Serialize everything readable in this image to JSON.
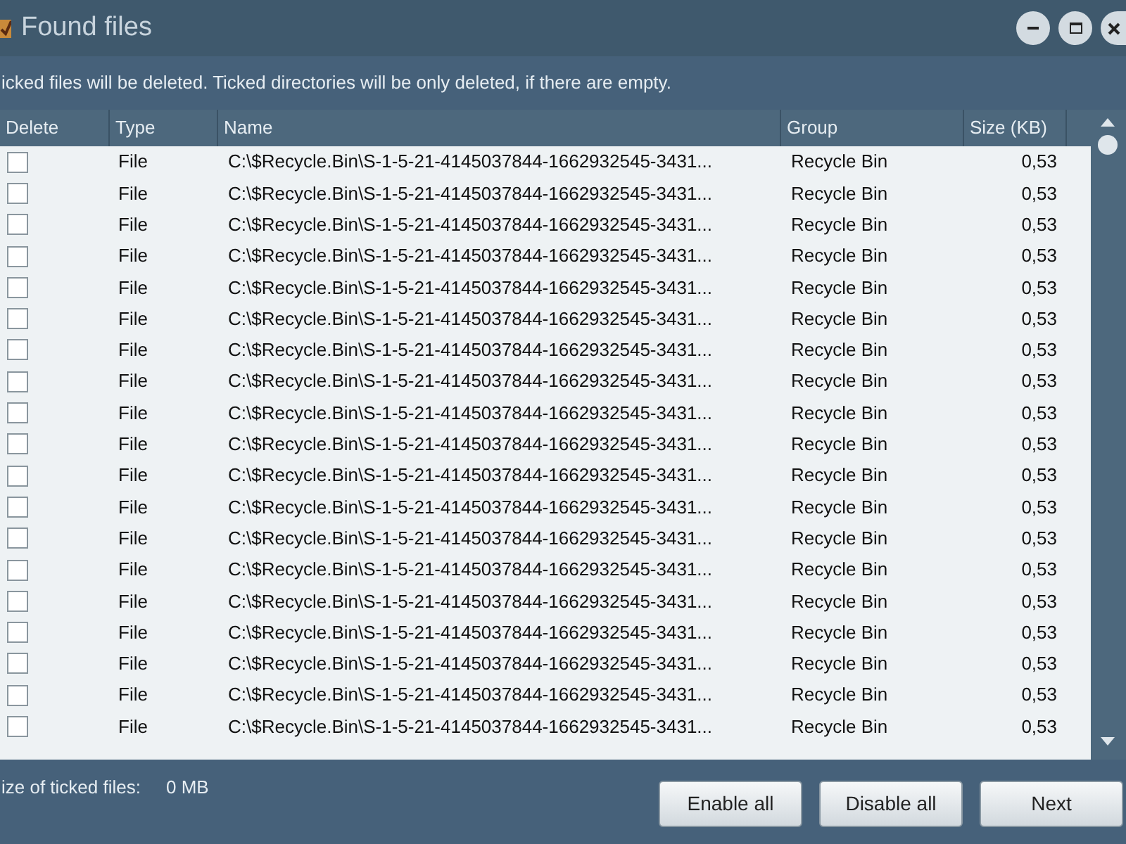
{
  "window": {
    "title": "Found files"
  },
  "message": "icked files will be deleted. Ticked directories will be only deleted, if there are empty.",
  "table": {
    "columns": [
      "Delete",
      "Type",
      "Name",
      "Group",
      "Size (KB)"
    ],
    "rows": [
      {
        "checked": false,
        "type": "File",
        "name": "C:\\$Recycle.Bin\\S-1-5-21-4145037844-1662932545-3431...",
        "group": "Recycle Bin",
        "size": "0,53"
      },
      {
        "checked": false,
        "type": "File",
        "name": "C:\\$Recycle.Bin\\S-1-5-21-4145037844-1662932545-3431...",
        "group": "Recycle Bin",
        "size": "0,53"
      },
      {
        "checked": false,
        "type": "File",
        "name": "C:\\$Recycle.Bin\\S-1-5-21-4145037844-1662932545-3431...",
        "group": "Recycle Bin",
        "size": "0,53"
      },
      {
        "checked": false,
        "type": "File",
        "name": "C:\\$Recycle.Bin\\S-1-5-21-4145037844-1662932545-3431...",
        "group": "Recycle Bin",
        "size": "0,53"
      },
      {
        "checked": false,
        "type": "File",
        "name": "C:\\$Recycle.Bin\\S-1-5-21-4145037844-1662932545-3431...",
        "group": "Recycle Bin",
        "size": "0,53"
      },
      {
        "checked": false,
        "type": "File",
        "name": "C:\\$Recycle.Bin\\S-1-5-21-4145037844-1662932545-3431...",
        "group": "Recycle Bin",
        "size": "0,53"
      },
      {
        "checked": false,
        "type": "File",
        "name": "C:\\$Recycle.Bin\\S-1-5-21-4145037844-1662932545-3431...",
        "group": "Recycle Bin",
        "size": "0,53"
      },
      {
        "checked": false,
        "type": "File",
        "name": "C:\\$Recycle.Bin\\S-1-5-21-4145037844-1662932545-3431...",
        "group": "Recycle Bin",
        "size": "0,53"
      },
      {
        "checked": false,
        "type": "File",
        "name": "C:\\$Recycle.Bin\\S-1-5-21-4145037844-1662932545-3431...",
        "group": "Recycle Bin",
        "size": "0,53"
      },
      {
        "checked": false,
        "type": "File",
        "name": "C:\\$Recycle.Bin\\S-1-5-21-4145037844-1662932545-3431...",
        "group": "Recycle Bin",
        "size": "0,53"
      },
      {
        "checked": false,
        "type": "File",
        "name": "C:\\$Recycle.Bin\\S-1-5-21-4145037844-1662932545-3431...",
        "group": "Recycle Bin",
        "size": "0,53"
      },
      {
        "checked": false,
        "type": "File",
        "name": "C:\\$Recycle.Bin\\S-1-5-21-4145037844-1662932545-3431...",
        "group": "Recycle Bin",
        "size": "0,53"
      },
      {
        "checked": false,
        "type": "File",
        "name": "C:\\$Recycle.Bin\\S-1-5-21-4145037844-1662932545-3431...",
        "group": "Recycle Bin",
        "size": "0,53"
      },
      {
        "checked": false,
        "type": "File",
        "name": "C:\\$Recycle.Bin\\S-1-5-21-4145037844-1662932545-3431...",
        "group": "Recycle Bin",
        "size": "0,53"
      },
      {
        "checked": false,
        "type": "File",
        "name": "C:\\$Recycle.Bin\\S-1-5-21-4145037844-1662932545-3431...",
        "group": "Recycle Bin",
        "size": "0,53"
      },
      {
        "checked": false,
        "type": "File",
        "name": "C:\\$Recycle.Bin\\S-1-5-21-4145037844-1662932545-3431...",
        "group": "Recycle Bin",
        "size": "0,53"
      },
      {
        "checked": false,
        "type": "File",
        "name": "C:\\$Recycle.Bin\\S-1-5-21-4145037844-1662932545-3431...",
        "group": "Recycle Bin",
        "size": "0,53"
      },
      {
        "checked": false,
        "type": "File",
        "name": "C:\\$Recycle.Bin\\S-1-5-21-4145037844-1662932545-3431...",
        "group": "Recycle Bin",
        "size": "0,53"
      },
      {
        "checked": false,
        "type": "File",
        "name": "C:\\$Recycle.Bin\\S-1-5-21-4145037844-1662932545-3431...",
        "group": "Recycle Bin",
        "size": "0,53"
      }
    ]
  },
  "status": {
    "label": "ize of ticked files:",
    "value": "0 MB"
  },
  "buttons": [
    "Enable all",
    "Disable all",
    "Next"
  ]
}
